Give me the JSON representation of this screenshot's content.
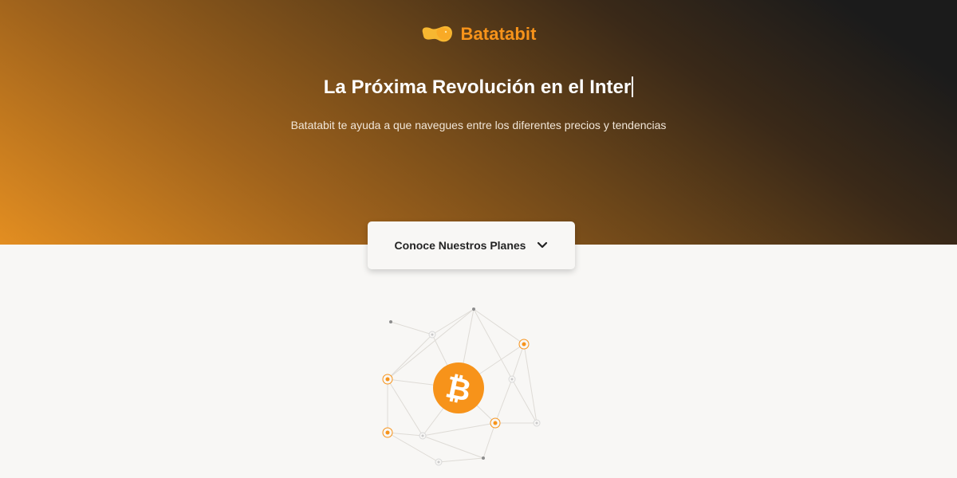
{
  "header": {
    "brand": "Batatabit",
    "logo_icon": "potato-logo-icon",
    "headline": "La Próxima Revolución en el Inter",
    "subtitle": "Batatabit te ayuda a que navegues entre los diferentes precios y tendencias"
  },
  "cta": {
    "label": "Conoce Nuestros Planes",
    "icon": "chevron-down-icon"
  },
  "illustration": {
    "icon": "bitcoin-icon",
    "symbol": "₿"
  },
  "colors": {
    "brand_orange": "#f7931a",
    "dark": "#1b1b1b",
    "background": "#f8f7f5"
  }
}
